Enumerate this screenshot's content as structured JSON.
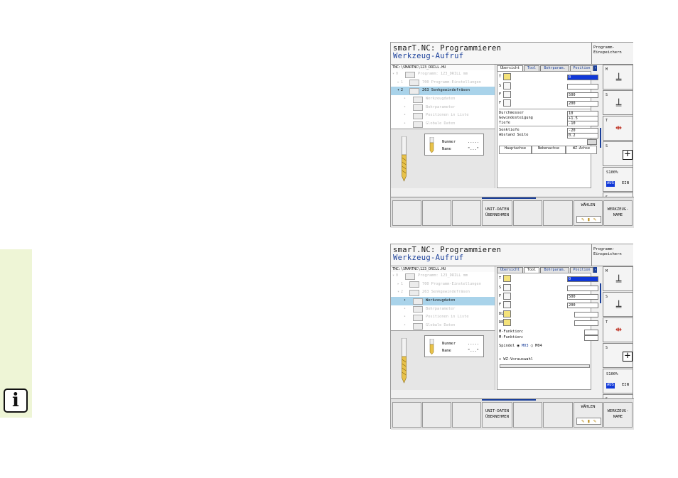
{
  "left_panel": {
    "info_icon": "info-icon",
    "info_label": "i",
    "accent": "#eef5d6"
  },
  "screens": [
    {
      "title_line1": "smarT.NC: Programmieren",
      "title_line2": "Werkzeug-Aufruf",
      "header_button": [
        "Programm-",
        "Einspeichern"
      ],
      "path": "TNC:\\SMARTNC\\123_DRILL.HU",
      "tree": [
        {
          "arrow": "▾",
          "num": "0",
          "label": "Programm: 123_DRILL mm",
          "selected": false,
          "indent": 0
        },
        {
          "arrow": "▸",
          "num": "1",
          "label": "700 Programm-Einstellungen",
          "selected": false,
          "indent": 1
        },
        {
          "arrow": "▾",
          "num": "2",
          "label": "263 Senkgewindefräsen",
          "selected": true,
          "indent": 1
        },
        {
          "arrow": "",
          "num": "",
          "label": "Werkzeugdaten",
          "selected": false,
          "indent": 2
        },
        {
          "arrow": "",
          "num": "",
          "label": "Bohrparameter",
          "selected": false,
          "indent": 2
        },
        {
          "arrow": "",
          "num": "",
          "label": "Positionen in Liste",
          "selected": false,
          "indent": 2
        },
        {
          "arrow": "",
          "num": "",
          "label": "Globale Daten",
          "selected": false,
          "indent": 2
        }
      ],
      "tool_card": {
        "nummer_label": "Nummer",
        "nummer_value": ".....",
        "name_label": "Name",
        "name_value": "\"...\""
      },
      "tabs": [
        "Übersicht",
        "Tool",
        "Bohrparam.",
        "Position"
      ],
      "active_tab": 0,
      "fields": {
        "T": "0",
        "S": "",
        "F1": "500",
        "F2": "200",
        "durchmesser_label": "Durchmesser",
        "durchmesser": "10",
        "gewindesteigung_label": "Gewindesteigung",
        "gewindesteigung": "+1.5",
        "tiefe_label": "Tiefe",
        "tiefe": "-10",
        "senktiefe_label": "Senktiefe",
        "senktiefe": "-20",
        "abstand_label": "Abstand Seite",
        "abstand": "0.2"
      },
      "axis_headers": [
        "Hauptachse",
        "Nebenachse",
        "WZ-Achse"
      ],
      "right_buttons": [
        "M",
        "S",
        "T",
        "S",
        "S100%",
        "S"
      ],
      "override_label": "S100%",
      "aus_label": "AUS",
      "ein_label": "EIN",
      "bottom": [
        "",
        "",
        "",
        "UNIT-DATEN\nÜBERNEHMEN",
        "",
        "",
        "WÄHLEN",
        "WERKZEUG-\nNAME"
      ]
    },
    {
      "title_line1": "smarT.NC: Programmieren",
      "title_line2": "Werkzeug-Aufruf",
      "header_button": [
        "Programm-",
        "Einspeichern"
      ],
      "path": "TNC:\\SMARTNC\\123_DRILL.HU",
      "tree": [
        {
          "arrow": "▾",
          "num": "0",
          "label": "Programm: 123_DRILL mm",
          "selected": false,
          "indent": 0
        },
        {
          "arrow": "▸",
          "num": "1",
          "label": "700 Programm-Einstellungen",
          "selected": false,
          "indent": 1
        },
        {
          "arrow": "▾",
          "num": "2",
          "label": "263 Senkgewindefräsen",
          "selected": false,
          "indent": 1
        },
        {
          "arrow": "",
          "num": "",
          "label": "Werkzeugdaten",
          "selected": true,
          "indent": 2
        },
        {
          "arrow": "",
          "num": "",
          "label": "Bohrparameter",
          "selected": false,
          "indent": 2
        },
        {
          "arrow": "",
          "num": "",
          "label": "Positionen in Liste",
          "selected": false,
          "indent": 2
        },
        {
          "arrow": "",
          "num": "",
          "label": "Globale Daten",
          "selected": false,
          "indent": 2
        }
      ],
      "tool_card": {
        "nummer_label": "Nummer",
        "nummer_value": ".....",
        "name_label": "Name",
        "name_value": "\"...\""
      },
      "tabs": [
        "Übersicht",
        "Tool",
        "Bohrparam.",
        "Position"
      ],
      "active_tab": 1,
      "fields": {
        "T": "0",
        "S": "",
        "F1": "500",
        "F2": "200",
        "DL": "",
        "DR": "",
        "mfunk1_label": "M-Funktion:",
        "mfunk2_label": "M-Funktion:",
        "spindel_label": "Spindel",
        "m03": "M03",
        "m04": "M04",
        "vorauswahl_label": "WZ-Vorauswahl"
      },
      "right_buttons": [
        "M",
        "S",
        "T",
        "S",
        "S100%",
        "S"
      ],
      "override_label": "S100%",
      "aus_label": "AUS",
      "ein_label": "EIN",
      "bottom": [
        "",
        "",
        "",
        "UNIT-DATEN\nÜBERNEHMEN",
        "",
        "",
        "WÄHLEN",
        "WERKZEUG-\nNAME"
      ]
    }
  ],
  "colors": {
    "selection": "#a9d3ea",
    "title_blue": "#1a3f9a",
    "field_blue": "#1038d8"
  }
}
